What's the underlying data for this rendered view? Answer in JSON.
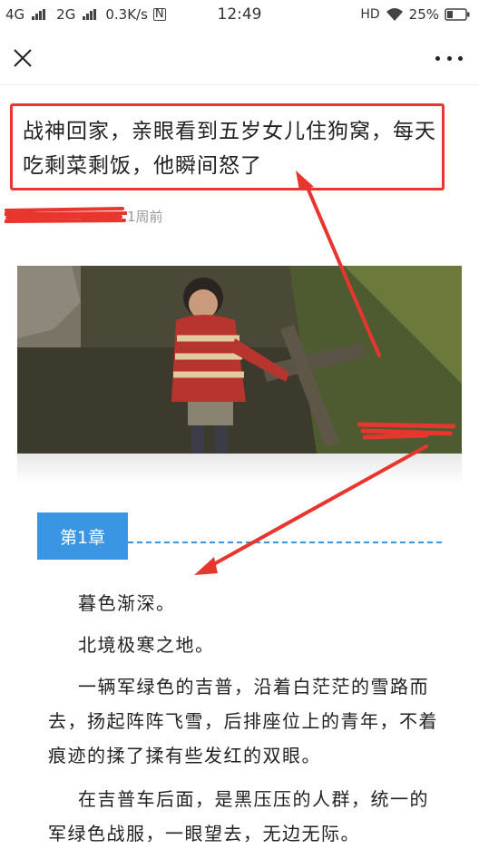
{
  "status_bar": {
    "net1": "4G",
    "net2": "2G",
    "speed": "0.3K/s",
    "time": "12:49",
    "hd": "HD",
    "battery": "25%"
  },
  "nav": {
    "close_icon": "close-icon",
    "more_icon": "more-icon"
  },
  "article": {
    "title": "战神回家，亲眼看到五岁女儿住狗窝，每天吃剩菜剩饭，他瞬间怒了",
    "time_ago": "1周前"
  },
  "chapter": {
    "label": "第1章"
  },
  "paragraphs": [
    "暮色渐深。",
    "北境极寒之地。",
    "一辆军绿色的吉普，沿着白茫茫的雪路而去，扬起阵阵飞雪，后排座位上的青年，不着痕迹的揉了揉有些发红的双眼。",
    "在吉普车后面，是黑压压的人群，统一的军绿色战服，一眼望去，无边无际。"
  ],
  "colors": {
    "annotation_red": "#e8362f",
    "chapter_blue": "#3a95e2"
  }
}
